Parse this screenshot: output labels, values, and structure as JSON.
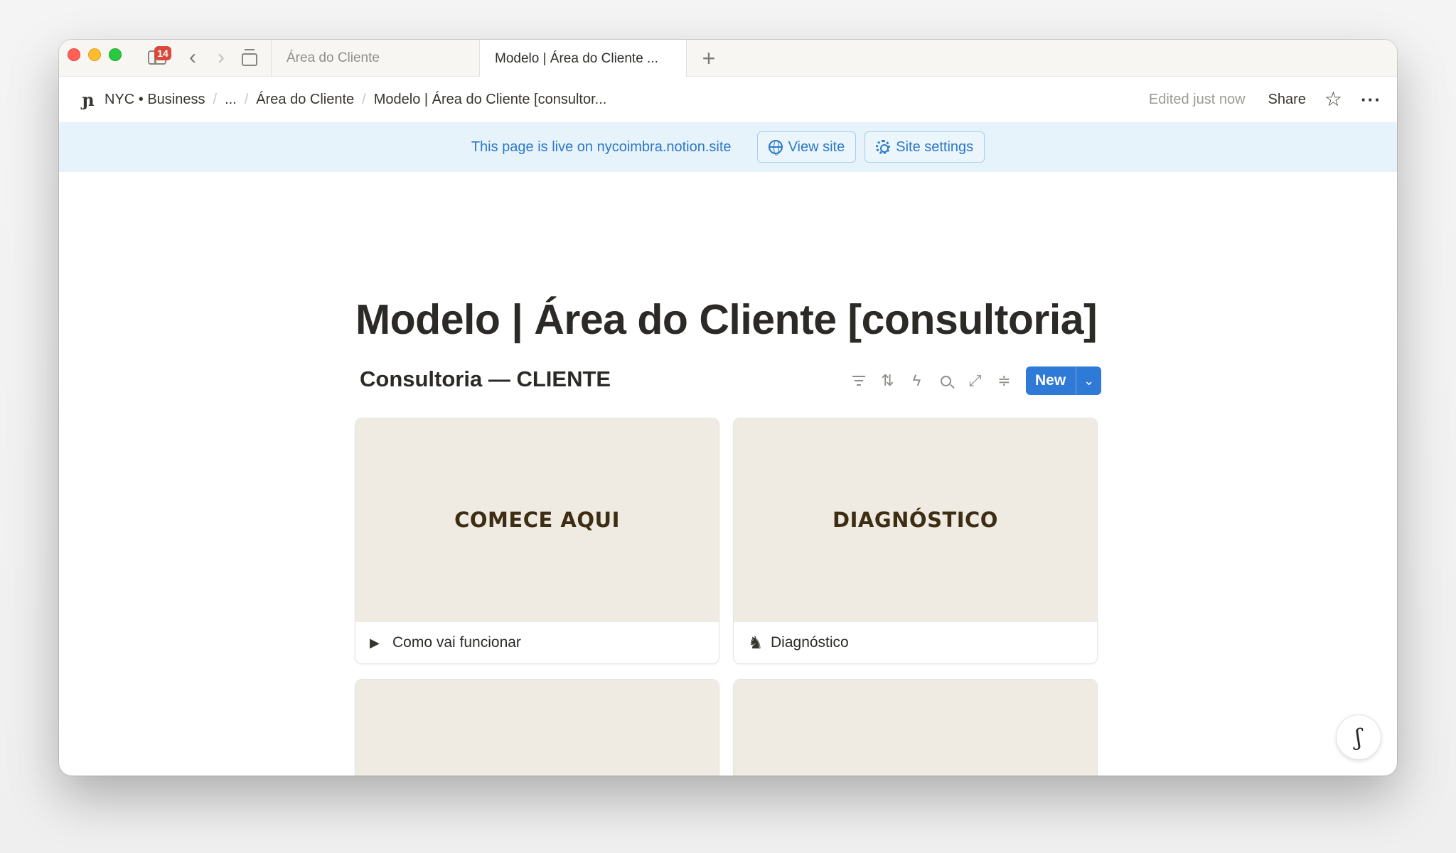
{
  "browser": {
    "tab_count_badge": "14",
    "tabs": [
      {
        "label": "Área do Cliente",
        "active": false
      },
      {
        "label": "Modelo | Área do Cliente ...",
        "active": true
      }
    ]
  },
  "topbar": {
    "workspace_logo": "ɲ",
    "breadcrumbs": [
      "NYC • Business",
      "...",
      "Área do Cliente",
      "Modelo | Área do Cliente [consultor..."
    ],
    "edited": "Edited just now",
    "share_label": "Share"
  },
  "banner": {
    "text": "This page is live on nycoimbra.notion.site",
    "view_site": "View site",
    "site_settings": "Site settings"
  },
  "page": {
    "title": "Modelo | Área do Cliente [consultoria]",
    "database_title": "Consultoria — CLIENTE",
    "new_label": "New"
  },
  "cards": [
    {
      "cover_text": "COMECE AQUI",
      "icon": "play-icon",
      "title": "Como vai funcionar"
    },
    {
      "cover_text": "DIAGNÓSTICO",
      "icon": "chess-knight-icon",
      "title": "Diagnóstico"
    }
  ],
  "colors": {
    "accent": "#2f7ad6",
    "banner_bg": "#e7f3fb",
    "banner_text": "#2e78c7",
    "card_cover": "#efebe3",
    "cover_text": "#3d2d12"
  }
}
